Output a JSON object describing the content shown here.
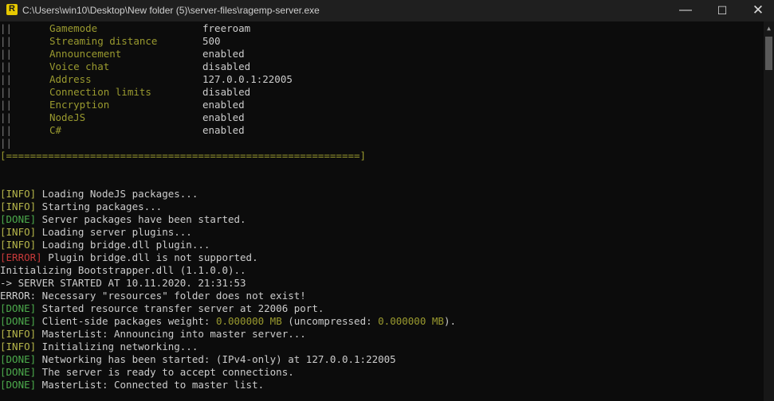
{
  "window": {
    "title": "C:\\Users\\win10\\Desktop\\New folder (5)\\server-files\\ragemp-server.exe",
    "icon": "ragemp-icon",
    "controls": {
      "minimize": "—",
      "maximize": "☐",
      "close": "✕"
    }
  },
  "config": {
    "bar": "||",
    "rows": [
      {
        "key": "Gamemode",
        "value": "freeroam"
      },
      {
        "key": "Streaming distance",
        "value": "500"
      },
      {
        "key": "Announcement",
        "value": "enabled"
      },
      {
        "key": "Voice chat",
        "value": "disabled"
      },
      {
        "key": "Address",
        "value": "127.0.0.1:22005"
      },
      {
        "key": "Connection limits",
        "value": "disabled"
      },
      {
        "key": "Encryption",
        "value": "enabled"
      },
      {
        "key": "NodeJS",
        "value": "enabled"
      },
      {
        "key": "C#",
        "value": "enabled"
      }
    ],
    "separator": "[===========================================================]"
  },
  "log": [
    {
      "tag": "[INFO]",
      "type": "info",
      "text": " Loading NodeJS packages..."
    },
    {
      "tag": "[INFO]",
      "type": "info",
      "text": " Starting packages..."
    },
    {
      "tag": "[DONE]",
      "type": "done",
      "text": " Server packages have been started."
    },
    {
      "tag": "[INFO]",
      "type": "info",
      "text": " Loading server plugins..."
    },
    {
      "tag": "[INFO]",
      "type": "info",
      "text": " Loading bridge.dll plugin..."
    },
    {
      "tag": "[ERROR]",
      "type": "error",
      "text": " Plugin bridge.dll is not supported."
    },
    {
      "tag": "",
      "type": "plain",
      "text": "Initializing Bootstrapper.dll (1.1.0.0).."
    },
    {
      "tag": "",
      "type": "plain",
      "text": "-> SERVER STARTED AT 10.11.2020. 21:31:53"
    },
    {
      "tag": "",
      "type": "plain",
      "text": "ERROR: Necessary \"resources\" folder does not exist!"
    },
    {
      "tag": "[DONE]",
      "type": "done",
      "text": " Started resource transfer server at 22006 port."
    },
    {
      "tag": "[DONE]",
      "type": "done",
      "text": " Client-side packages weight: ",
      "n1": "0.000000 MB",
      "mid": " (uncompressed: ",
      "n2": "0.000000 MB",
      "end": ")."
    },
    {
      "tag": "[INFO]",
      "type": "info",
      "text": " MasterList: Announcing into master server..."
    },
    {
      "tag": "[INFO]",
      "type": "info",
      "text": " Initializing networking..."
    },
    {
      "tag": "[DONE]",
      "type": "done",
      "text": " Networking has been started: (IPv4-only) at 127.0.0.1:22005"
    },
    {
      "tag": "[DONE]",
      "type": "done",
      "text": " The server is ready to accept connections."
    },
    {
      "tag": "[DONE]",
      "type": "done",
      "text": " MasterList: Connected to master list."
    }
  ],
  "scrollbar": {
    "up": "▲"
  }
}
